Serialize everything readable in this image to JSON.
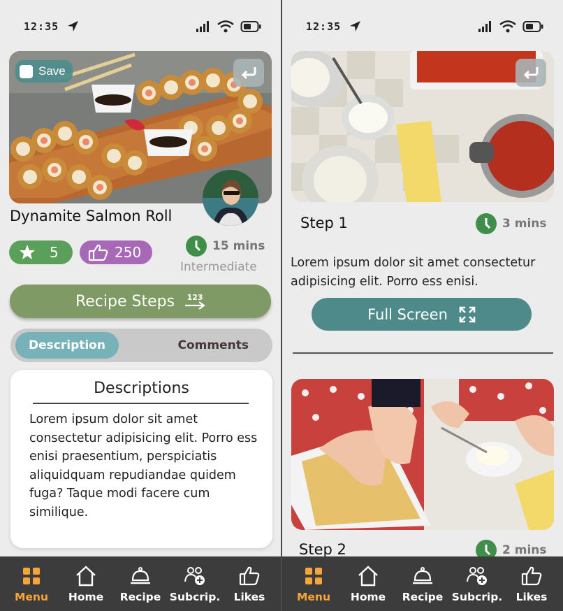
{
  "status": {
    "time": "12:35"
  },
  "left": {
    "save_label": "Save",
    "recipe_title": "Dynamite Salmon Roll",
    "rating": "5",
    "likes": "250",
    "time": "15 mins",
    "level": "Intermediate",
    "recipe_steps_label": "Recipe Steps",
    "recipe_steps_badge": "123",
    "tabs": {
      "description": "Description",
      "comments": "Comments"
    },
    "descriptions_title": "Descriptions",
    "descriptions_text": "Lorem ipsum dolor sit amet consectetur adipisicing elit. Porro ess enisi praesentium, perspiciatis aliquidquam repudiandae quidem fuga? Taque modi facere cum similique."
  },
  "right": {
    "step1_label": "Step 1",
    "step1_time": "3 mins",
    "step1_text": "Lorem ipsum dolor sit amet consectetur adipisicing elit. Porro ess enisi.",
    "full_screen_label": "Full Screen",
    "step2_label": "Step 2",
    "step2_time": "2 mins"
  },
  "nav": {
    "items": [
      {
        "label": "Menu",
        "icon": "grid-icon"
      },
      {
        "label": "Home",
        "icon": "home-icon"
      },
      {
        "label": "Recipe",
        "icon": "cloche-icon"
      },
      {
        "label": "Subcrip.",
        "icon": "users-plus-icon"
      },
      {
        "label": "Likes",
        "icon": "thumbs-up-icon"
      }
    ]
  },
  "colors": {
    "accent_orange": "#f5a53a",
    "teal": "#4e8a8a",
    "green": "#5aa05a",
    "purple": "#a868b8",
    "olive": "#7f9a64",
    "nav_bg": "#3c3c3c"
  }
}
